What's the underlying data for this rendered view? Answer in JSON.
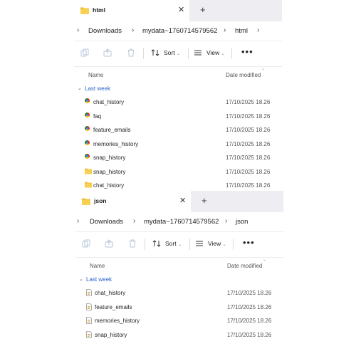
{
  "top_window": {
    "tab_title": "html",
    "tab_close": "✕",
    "new_tab": "+",
    "breadcrumb": [
      "Downloads",
      "mydata~1760714579562",
      "html"
    ],
    "toolbar": {
      "sort": "Sort",
      "view": "View",
      "more": "•••"
    },
    "columns": {
      "name": "Name",
      "date": "Date modified"
    },
    "group": "Last week",
    "rows": [
      {
        "name": "chat_history",
        "date": "17/10/2025 18.26",
        "icon": "chrome-html-icon"
      },
      {
        "name": "faq",
        "date": "17/10/2025 18.26",
        "icon": "chrome-html-icon"
      },
      {
        "name": "feature_emails",
        "date": "17/10/2025 18.26",
        "icon": "chrome-html-icon"
      },
      {
        "name": "memories_history",
        "date": "17/10/2025 18.26",
        "icon": "chrome-html-icon"
      },
      {
        "name": "snap_history",
        "date": "17/10/2025 18.26",
        "icon": "chrome-html-icon"
      },
      {
        "name": "snap_history",
        "date": "17/10/2025 18.26",
        "icon": "folder-icon"
      },
      {
        "name": "chat_history",
        "date": "17/10/2025 18.26",
        "icon": "folder-icon"
      }
    ]
  },
  "bottom_window": {
    "tab_title": "json",
    "tab_close": "✕",
    "new_tab": "+",
    "breadcrumb": [
      "Downloads",
      "mydata~1760714579562",
      "json"
    ],
    "toolbar": {
      "sort": "Sort",
      "view": "View",
      "more": "•••"
    },
    "columns": {
      "name": "Name",
      "date": "Date modified"
    },
    "group": "Last week",
    "rows": [
      {
        "name": "chat_history",
        "date": "17/10/2025 18.26",
        "icon": "json-file-icon"
      },
      {
        "name": "feature_emails",
        "date": "17/10/2025 18.26",
        "icon": "json-file-icon"
      },
      {
        "name": "memories_history",
        "date": "17/10/2025 18.26",
        "icon": "json-file-icon"
      },
      {
        "name": "snap_history",
        "date": "17/10/2025 18.26",
        "icon": "json-file-icon"
      }
    ]
  },
  "colors": {
    "folder": "#f3c03d",
    "group_label": "#2a63c9",
    "tabbar_bg": "#eeeef2"
  }
}
